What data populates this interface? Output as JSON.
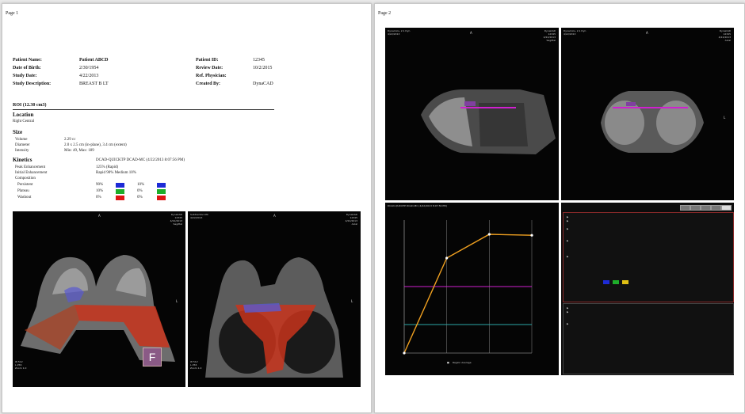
{
  "page1": {
    "label": "Page 1",
    "patient": {
      "name_label": "Patient Name:",
      "name": "Patient ABCD",
      "dob_label": "Date of Birth:",
      "dob": "2/30/1954",
      "study_date_label": "Study Date:",
      "study_date": "4/22/2013",
      "study_desc_label": "Study Description:",
      "study_desc": "BREAST B LT",
      "id_label": "Patient ID:",
      "id": "12345",
      "review_label": "Review Date:",
      "review": "10/2/2015",
      "physician_label": "Ref. Physician:",
      "physician": "",
      "created_label": "Created By:",
      "created": "DynaCAD"
    },
    "roi_title": "ROI (12.30 cm3)",
    "location_title": "Location",
    "location_value": "Right Central",
    "size_title": "Size",
    "size": {
      "volume_label": "Volume",
      "volume": "2.29 cc",
      "diameter_label": "Diameter",
      "diameter": "2.0 x 2.5 cm (in-plane), 3.4 cm (extent)",
      "intensity_label": "Intensity",
      "intensity": "Min: 49, Max: 189"
    },
    "kinetics_title": "Kinetics",
    "kinetics_series": "DCAD-QUICKTP DCAD-MC (4/22/2013 8:07:56 PM)",
    "kinetics": {
      "peak_label": "Peak Enhancement",
      "peak": "125% (Rapid)",
      "initial_label": "Initial Enhancement",
      "initial": "Rapid 90%   Medium 10%",
      "composition_label": "Composition",
      "rows": [
        {
          "label": "Persistent",
          "a": "90%",
          "b": "10%"
        },
        {
          "label": "Plateau",
          "a": "10%",
          "b": "0%"
        },
        {
          "label": "Washout",
          "a": "0%",
          "b": "0%"
        }
      ]
    },
    "logo_letter": "F"
  },
  "page2": {
    "label": "Page 2",
    "legend": "Region Average",
    "chart_data": {
      "type": "line",
      "x": [
        0,
        1,
        2,
        3
      ],
      "y": [
        0,
        100,
        125,
        124
      ],
      "ylim": [
        0,
        140
      ],
      "xlim": [
        0,
        3
      ],
      "threshold_lines": [
        70,
        30
      ],
      "grid": false,
      "line_color": "#f0a020"
    }
  },
  "colors": {
    "swatch_blue": "#1d2bd6",
    "swatch_green": "#1eae2a",
    "swatch_red": "#e01414",
    "chart_line": "#f0a020",
    "threshold_magenta": "#d020d0",
    "threshold_cyan": "#2aa6a6",
    "mri_overlay_red": "#c8341c",
    "mri_overlay_blue": "#5a5ad0"
  }
}
